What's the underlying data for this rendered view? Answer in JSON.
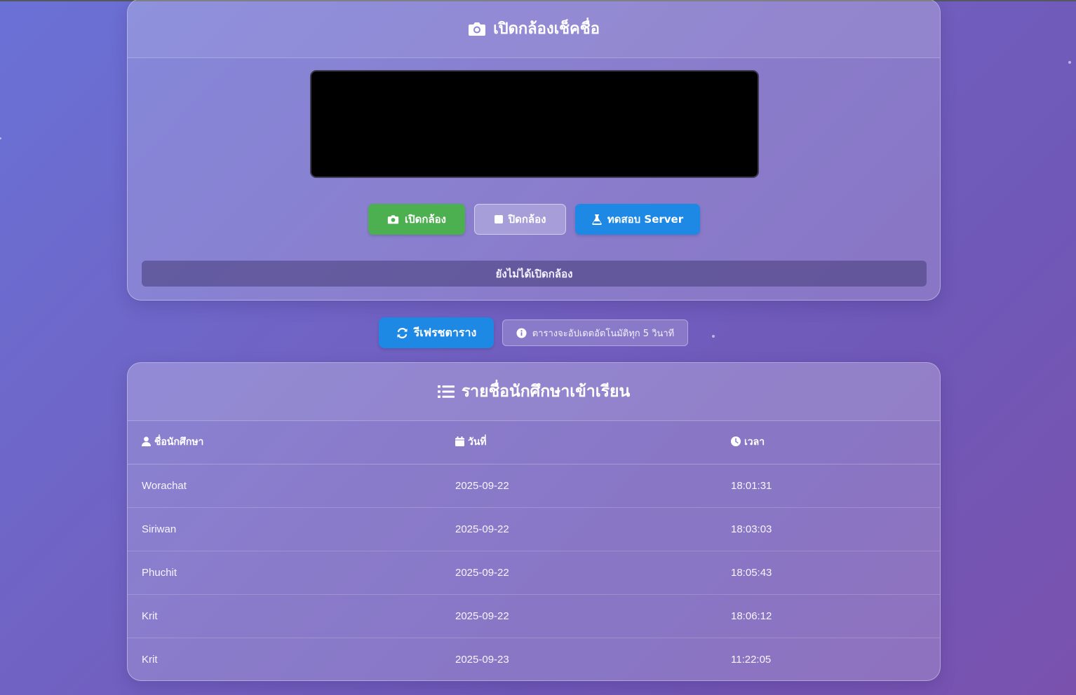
{
  "camera_card": {
    "title": "เปิดกล้องเช็คชื่อ",
    "buttons": {
      "open_label": "เปิดกล้อง",
      "close_label": "ปิดกล้อง",
      "test_label": "ทดสอบ Server"
    },
    "status": "ยังไม่ได้เปิดกล้อง"
  },
  "controls": {
    "refresh_label": "รีเฟรชตาราง",
    "auto_note": "ตารางจะอัปเดตอัตโนมัติทุก 5 วินาที"
  },
  "attendance": {
    "title": "รายชื่อนักศึกษาเข้าเรียน",
    "columns": {
      "name": "ชื่อนักศึกษา",
      "date": "วันที่",
      "time": "เวลา"
    },
    "rows": [
      {
        "name": "Worachat",
        "date": "2025-09-22",
        "time": "18:01:31"
      },
      {
        "name": "Siriwan",
        "date": "2025-09-22",
        "time": "18:03:03"
      },
      {
        "name": "Phuchit",
        "date": "2025-09-22",
        "time": "18:05:43"
      },
      {
        "name": "Krit",
        "date": "2025-09-22",
        "time": "18:06:12"
      },
      {
        "name": "Krit",
        "date": "2025-09-23",
        "time": "11:22:05"
      }
    ]
  },
  "colors": {
    "open_button": "#4caf50",
    "primary_button": "#1e88e5",
    "video_background": "#000000"
  }
}
